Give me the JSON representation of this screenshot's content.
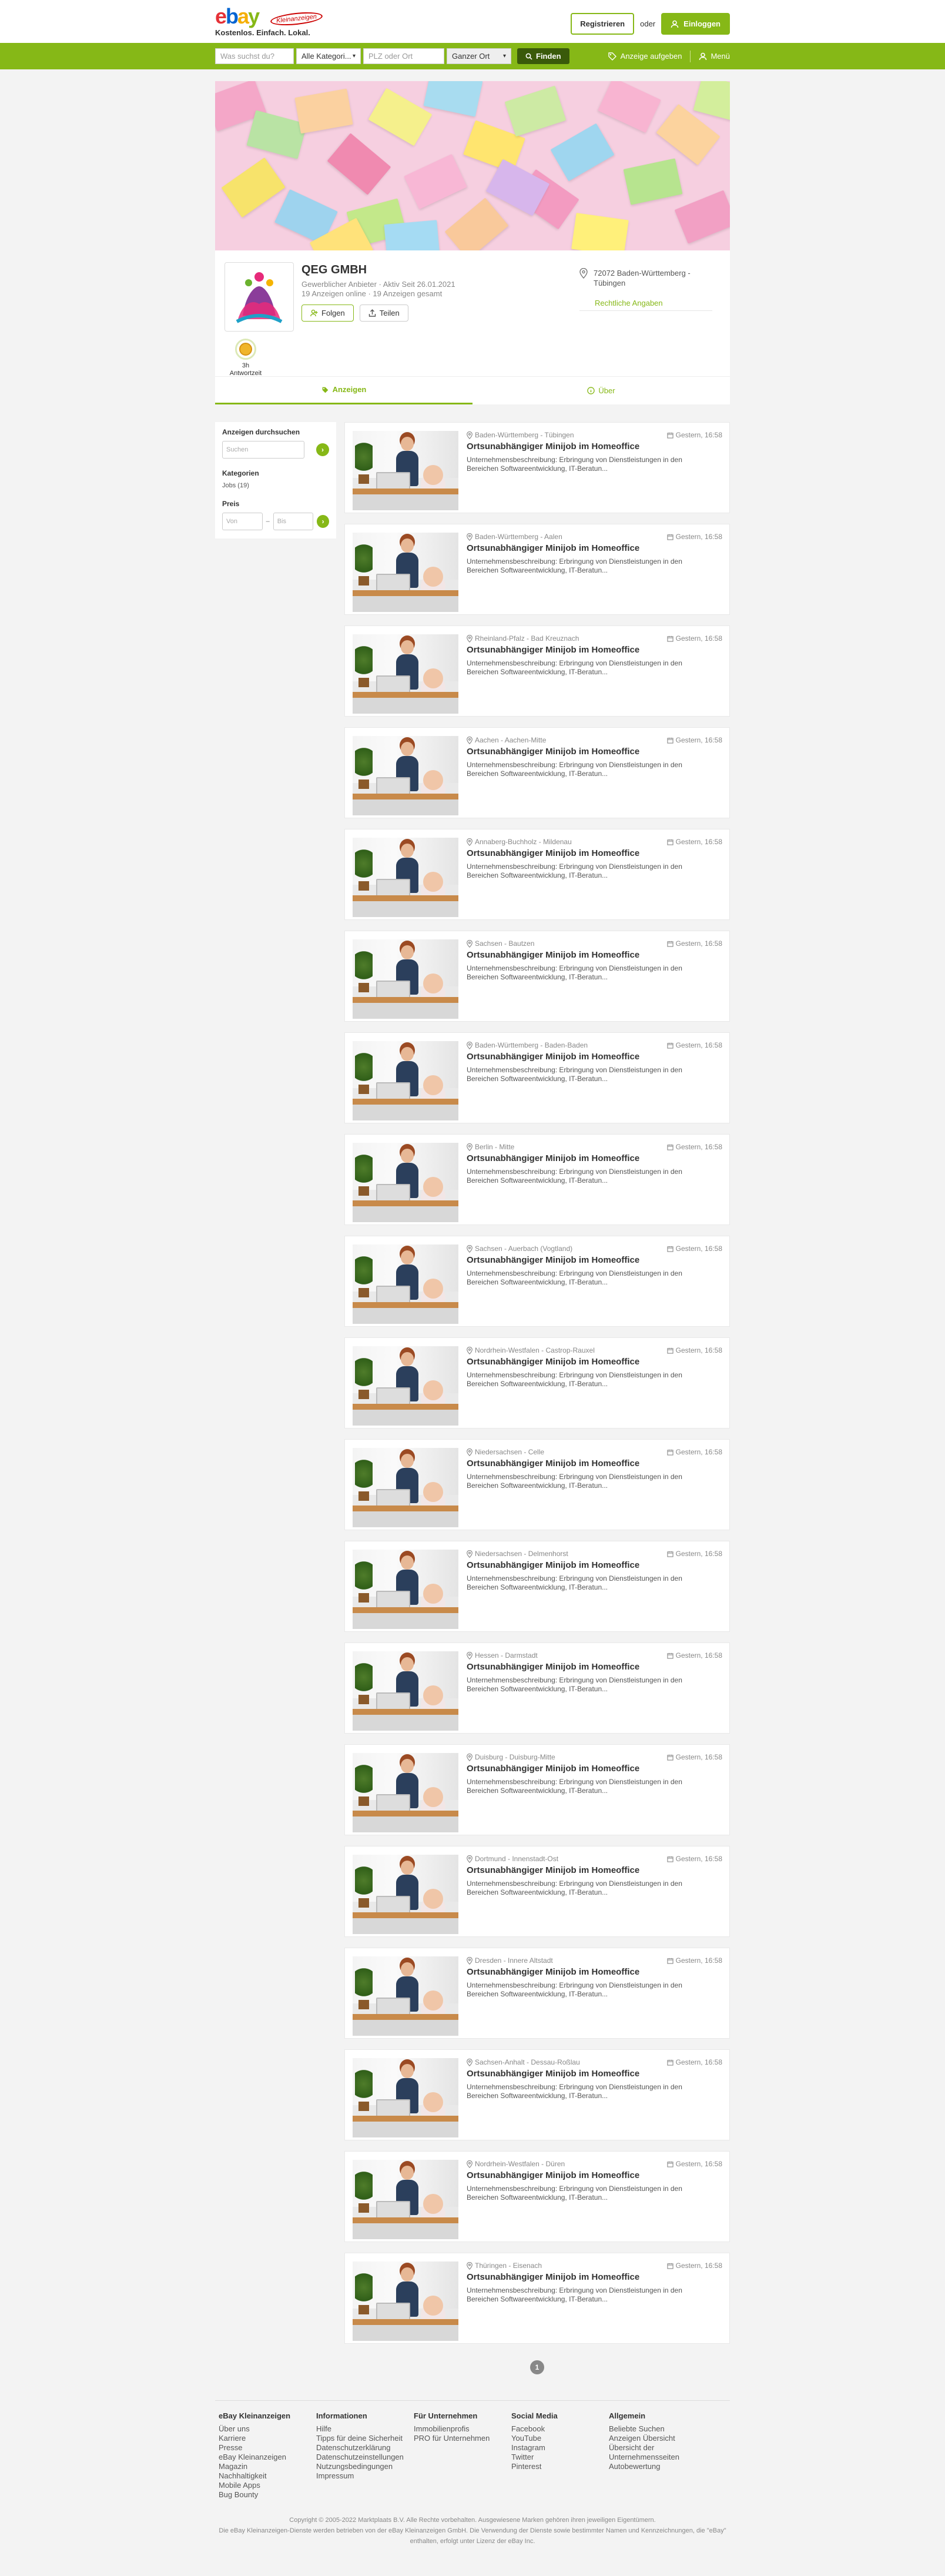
{
  "header": {
    "logo_text": [
      "e",
      "b",
      "a",
      "y"
    ],
    "logo_badge": "Kleinanzeigen",
    "slogan": "Kostenlos. Einfach. Lokal.",
    "register": "Registrieren",
    "or": "oder",
    "login": "Einloggen"
  },
  "search": {
    "query_placeholder": "Was suchst du?",
    "category": "Alle Kategori...",
    "location_placeholder": "PLZ oder Ort",
    "radius": "Ganzer Ort",
    "find": "Finden",
    "post_ad": "Anzeige aufgeben",
    "menu": "Menü"
  },
  "profile": {
    "name": "QEG GMBH",
    "line1": "Gewerblicher Anbieter · Aktiv Seit 26.01.2021",
    "line2": "19 Anzeigen online · 19 Anzeigen gesamt",
    "follow": "Folgen",
    "share": "Teilen",
    "location": "72072 Baden-Württemberg - Tübingen",
    "legal": "Rechtliche Angaben",
    "badge_title": "3h",
    "badge_label": "Antwortzeit"
  },
  "tabs": [
    {
      "label": "Anzeigen"
    },
    {
      "label": "Über"
    }
  ],
  "sidebar": {
    "search_title": "Anzeigen durchsuchen",
    "search_placeholder": "Suchen",
    "categories_title": "Kategorien",
    "category_item": "Jobs (19)",
    "price_title": "Preis",
    "price_from": "Von",
    "price_to": "Bis",
    "price_sep": "–"
  },
  "listings": [
    {
      "location": "Baden-Württemberg - Tübingen",
      "time": "Gestern, 16:58",
      "title": "Ortsunabhängiger Minijob im Homeoffice",
      "desc": "Unternehmensbeschreibung: Erbringung von Dienstleistungen in den Bereichen Softwareentwicklung, IT-Beratun..."
    },
    {
      "location": "Baden-Württemberg - Aalen",
      "time": "Gestern, 16:58",
      "title": "Ortsunabhängiger Minijob im Homeoffice",
      "desc": "Unternehmensbeschreibung: Erbringung von Dienstleistungen in den Bereichen Softwareentwicklung, IT-Beratun..."
    },
    {
      "location": "Rheinland-Pfalz - Bad Kreuznach",
      "time": "Gestern, 16:58",
      "title": "Ortsunabhängiger Minijob im Homeoffice",
      "desc": "Unternehmensbeschreibung: Erbringung von Dienstleistungen in den Bereichen Softwareentwicklung, IT-Beratun..."
    },
    {
      "location": "Aachen - Aachen-Mitte",
      "time": "Gestern, 16:58",
      "title": "Ortsunabhängiger Minijob im Homeoffice",
      "desc": "Unternehmensbeschreibung: Erbringung von Dienstleistungen in den Bereichen Softwareentwicklung, IT-Beratun..."
    },
    {
      "location": "Annaberg-Buchholz - Mildenau",
      "time": "Gestern, 16:58",
      "title": "Ortsunabhängiger Minijob im Homeoffice",
      "desc": "Unternehmensbeschreibung: Erbringung von Dienstleistungen in den Bereichen Softwareentwicklung, IT-Beratun..."
    },
    {
      "location": "Sachsen - Bautzen",
      "time": "Gestern, 16:58",
      "title": "Ortsunabhängiger Minijob im Homeoffice",
      "desc": "Unternehmensbeschreibung: Erbringung von Dienstleistungen in den Bereichen Softwareentwicklung, IT-Beratun..."
    },
    {
      "location": "Baden-Württemberg - Baden-Baden",
      "time": "Gestern, 16:58",
      "title": "Ortsunabhängiger Minijob im Homeoffice",
      "desc": "Unternehmensbeschreibung: Erbringung von Dienstleistungen in den Bereichen Softwareentwicklung, IT-Beratun..."
    },
    {
      "location": "Berlin - Mitte",
      "time": "Gestern, 16:58",
      "title": "Ortsunabhängiger Minijob im Homeoffice",
      "desc": "Unternehmensbeschreibung: Erbringung von Dienstleistungen in den Bereichen Softwareentwicklung, IT-Beratun..."
    },
    {
      "location": "Sachsen - Auerbach (Vogtland)",
      "time": "Gestern, 16:58",
      "title": "Ortsunabhängiger Minijob im Homeoffice",
      "desc": "Unternehmensbeschreibung: Erbringung von Dienstleistungen in den Bereichen Softwareentwicklung, IT-Beratun..."
    },
    {
      "location": "Nordrhein-Westfalen - Castrop-Rauxel",
      "time": "Gestern, 16:58",
      "title": "Ortsunabhängiger Minijob im Homeoffice",
      "desc": "Unternehmensbeschreibung: Erbringung von Dienstleistungen in den Bereichen Softwareentwicklung, IT-Beratun..."
    },
    {
      "location": "Niedersachsen - Celle",
      "time": "Gestern, 16:58",
      "title": "Ortsunabhängiger Minijob im Homeoffice",
      "desc": "Unternehmensbeschreibung: Erbringung von Dienstleistungen in den Bereichen Softwareentwicklung, IT-Beratun..."
    },
    {
      "location": "Niedersachsen - Delmenhorst",
      "time": "Gestern, 16:58",
      "title": "Ortsunabhängiger Minijob im Homeoffice",
      "desc": "Unternehmensbeschreibung: Erbringung von Dienstleistungen in den Bereichen Softwareentwicklung, IT-Beratun..."
    },
    {
      "location": "Hessen - Darmstadt",
      "time": "Gestern, 16:58",
      "title": "Ortsunabhängiger Minijob im Homeoffice",
      "desc": "Unternehmensbeschreibung: Erbringung von Dienstleistungen in den Bereichen Softwareentwicklung, IT-Beratun..."
    },
    {
      "location": "Duisburg - Duisburg-Mitte",
      "time": "Gestern, 16:58",
      "title": "Ortsunabhängiger Minijob im Homeoffice",
      "desc": "Unternehmensbeschreibung: Erbringung von Dienstleistungen in den Bereichen Softwareentwicklung, IT-Beratun..."
    },
    {
      "location": "Dortmund - Innenstadt-Ost",
      "time": "Gestern, 16:58",
      "title": "Ortsunabhängiger Minijob im Homeoffice",
      "desc": "Unternehmensbeschreibung: Erbringung von Dienstleistungen in den Bereichen Softwareentwicklung, IT-Beratun..."
    },
    {
      "location": "Dresden - Innere Altstadt",
      "time": "Gestern, 16:58",
      "title": "Ortsunabhängiger Minijob im Homeoffice",
      "desc": "Unternehmensbeschreibung: Erbringung von Dienstleistungen in den Bereichen Softwareentwicklung, IT-Beratun..."
    },
    {
      "location": "Sachsen-Anhalt - Dessau-Roßlau",
      "time": "Gestern, 16:58",
      "title": "Ortsunabhängiger Minijob im Homeoffice",
      "desc": "Unternehmensbeschreibung: Erbringung von Dienstleistungen in den Bereichen Softwareentwicklung, IT-Beratun..."
    },
    {
      "location": "Nordrhein-Westfalen - Düren",
      "time": "Gestern, 16:58",
      "title": "Ortsunabhängiger Minijob im Homeoffice",
      "desc": "Unternehmensbeschreibung: Erbringung von Dienstleistungen in den Bereichen Softwareentwicklung, IT-Beratun..."
    },
    {
      "location": "Thüringen - Eisenach",
      "time": "Gestern, 16:58",
      "title": "Ortsunabhängiger Minijob im Homeoffice",
      "desc": "Unternehmensbeschreibung: Erbringung von Dienstleistungen in den Bereichen Softwareentwicklung, IT-Beratun..."
    }
  ],
  "pagination": {
    "current": "1"
  },
  "footer": {
    "columns": [
      {
        "title": "eBay Kleinanzeigen",
        "links": [
          "Über uns",
          "Karriere",
          "Presse",
          "eBay Kleinanzeigen Magazin",
          "Nachhaltigkeit",
          "Mobile Apps",
          "Bug Bounty"
        ]
      },
      {
        "title": "Informationen",
        "links": [
          "Hilfe",
          "Tipps für deine Sicherheit",
          "Datenschutzerklärung",
          "Datenschutzeinstellungen",
          "Nutzungsbedingungen",
          "Impressum"
        ]
      },
      {
        "title": "Für Unternehmen",
        "links": [
          "Immobilienprofis",
          "PRO für Unternehmen"
        ]
      },
      {
        "title": "Social Media",
        "links": [
          "Facebook",
          "YouTube",
          "Instagram",
          "Twitter",
          "Pinterest"
        ]
      },
      {
        "title": "Allgemein",
        "links": [
          "Beliebte Suchen",
          "Anzeigen Übersicht",
          "Übersicht der Unternehmensseiten",
          "Autobewertung"
        ]
      }
    ],
    "copyright1": "Copyright © 2005-2022 Marktplaats B.V. Alle Rechte vorbehalten. Ausgewiesene Marken gehören ihren jeweiligen Eigentümern.",
    "copyright2": "Die eBay Kleinanzeigen-Dienste werden betrieben von der eBay Kleinanzeigen GmbH. Die Verwendung der Dienste sowie bestimmter Namen und Kennzeichnungen, die \"eBay\"",
    "copyright3": "enthalten, erfolgt unter Lizenz der eBay Inc."
  },
  "colors": {
    "brand_green": "#86b817",
    "dark_green": "#3a5a0a"
  }
}
